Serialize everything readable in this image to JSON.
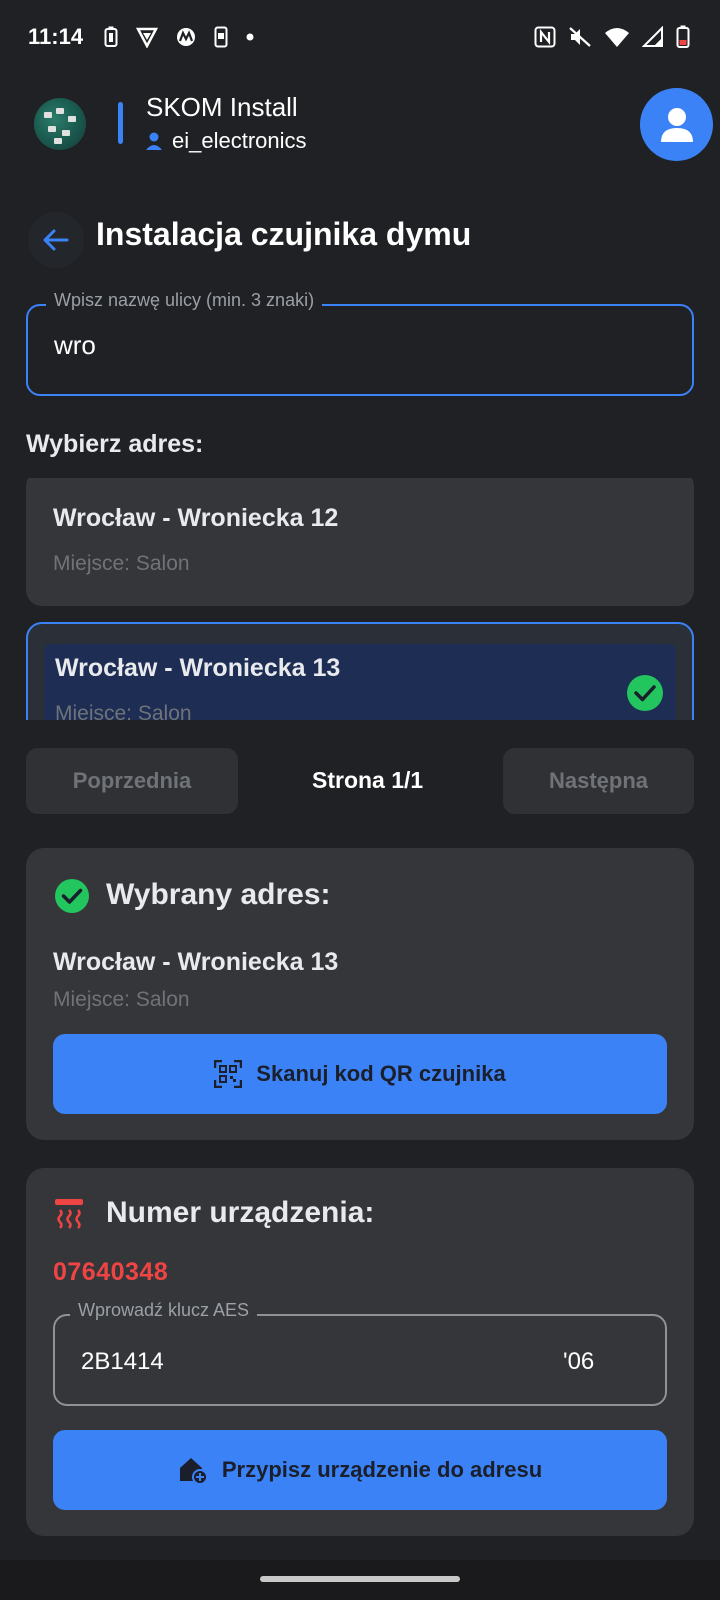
{
  "status_bar": {
    "time": "11:14"
  },
  "header": {
    "app_title": "SKOM Install",
    "username": "ei_electronics"
  },
  "page": {
    "title": "Instalacja czujnika dymu"
  },
  "search": {
    "label": "Wpisz nazwę ulicy (min. 3 znaki)",
    "value": "wro"
  },
  "address_list": {
    "heading": "Wybierz adres:",
    "items": [
      {
        "name": "Wrocław - Wroniecka 12",
        "place": "Miejsce: Salon",
        "selected": false
      },
      {
        "name": "Wrocław - Wroniecka 13",
        "place": "Miejsce: Salon",
        "selected": true
      }
    ]
  },
  "pagination": {
    "prev_label": "Poprzednia",
    "page_label": "Strona 1/1",
    "next_label": "Następna"
  },
  "selected_address": {
    "heading": "Wybrany adres:",
    "name": "Wrocław - Wroniecka 13",
    "place": "Miejsce: Salon",
    "scan_button_label": "Skanuj kod QR czujnika"
  },
  "device": {
    "heading": "Numer urządzenia:",
    "number": "07640348",
    "aes_label": "Wprowadź klucz AES",
    "aes_value_start": "2B1414",
    "aes_value_end": "'06",
    "assign_button_label": "Przypisz urządzenie do adresu"
  },
  "colors": {
    "accent": "#3b82f6",
    "success": "#22c55e",
    "error": "#ef4444",
    "background": "#202124",
    "card": "#35363a"
  },
  "icons": {
    "back": "arrow-left-icon",
    "avatar": "user-icon",
    "check": "check-circle-icon",
    "qr": "qr-scan-icon",
    "detector": "smoke-detector-icon",
    "assign": "home-add-icon"
  }
}
